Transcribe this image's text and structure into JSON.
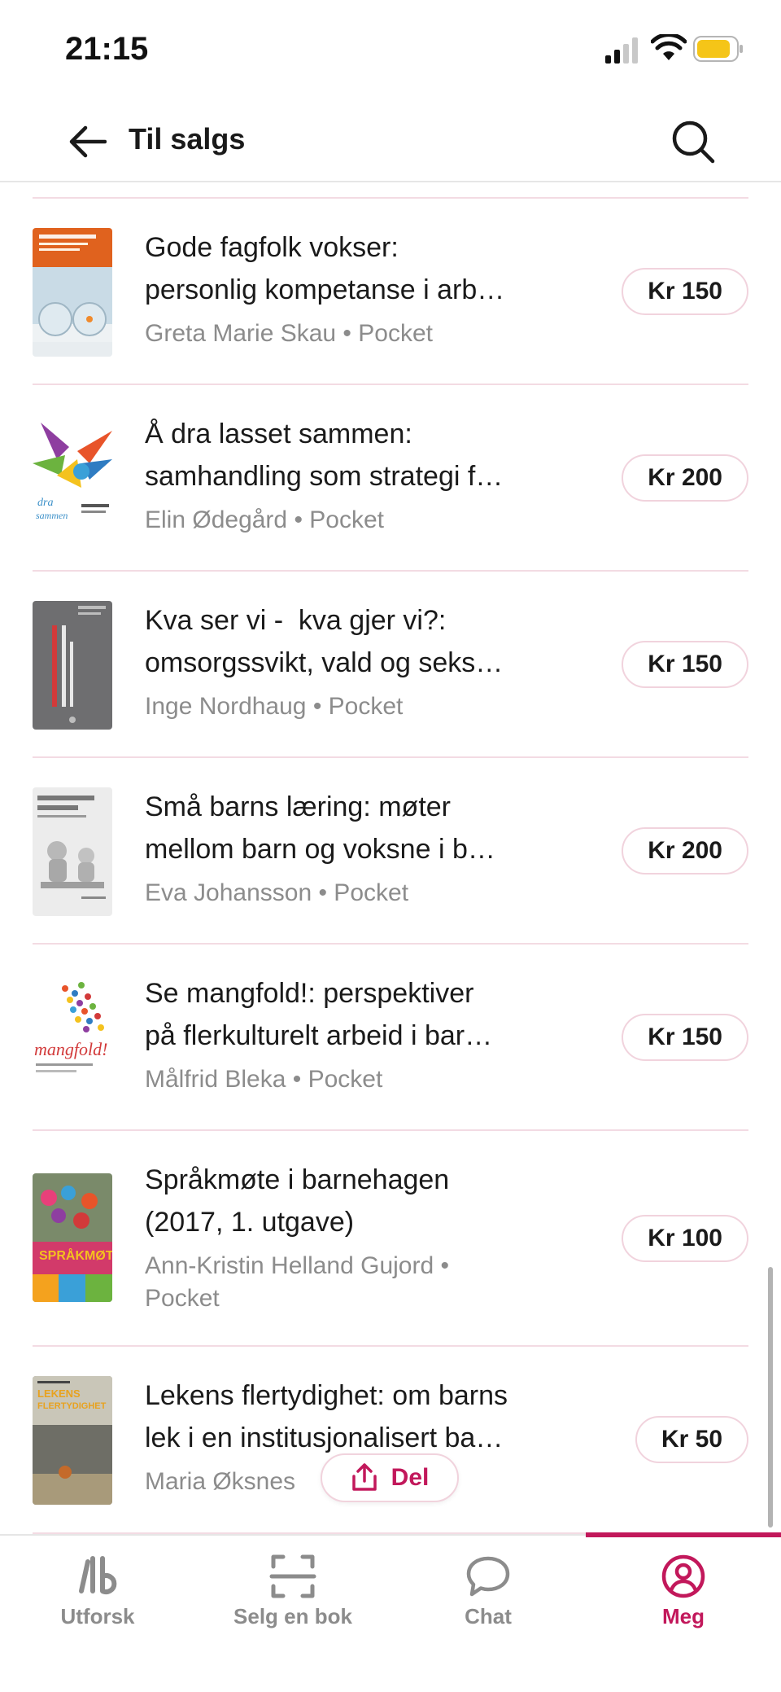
{
  "status_bar": {
    "time": "21:15"
  },
  "header": {
    "title": "Til salgs"
  },
  "books": [
    {
      "title_line1": "Gode fagfolk vokser:",
      "title_line2": "personlig kompetanse i arb…",
      "meta": "Greta Marie Skau • Pocket",
      "price": "Kr 150"
    },
    {
      "title_line1": "Å dra lasset sammen:",
      "title_line2": "samhandling som strategi f…",
      "meta": "Elin Ødegård • Pocket",
      "price": "Kr 200"
    },
    {
      "title_line1": "Kva ser vi -  kva gjer vi?:",
      "title_line2": "omsorgssvikt, vald og seks…",
      "meta": "Inge Nordhaug • Pocket",
      "price": "Kr 150"
    },
    {
      "title_line1": "Små barns læring: møter",
      "title_line2": "mellom barn og voksne i b…",
      "meta": "Eva Johansson • Pocket",
      "price": "Kr 200"
    },
    {
      "title_line1": "Se mangfold!: perspektiver",
      "title_line2": "på flerkulturelt arbeid i bar…",
      "meta": "Målfrid Bleka • Pocket",
      "price": "Kr 150"
    },
    {
      "title_line1": "Språkmøte i barnehagen",
      "title_line2": "(2017, 1. utgave)",
      "meta_line1": "Ann-Kristin Helland Gujord •",
      "meta_line2": "Pocket",
      "price": "Kr 100"
    },
    {
      "title_line1": "Lekens flertydighet: om barns",
      "title_line2": "lek i en institusjonalisert ba…",
      "meta": "Maria Øksnes",
      "price": "Kr 50"
    }
  ],
  "share": {
    "label": "Del"
  },
  "bottom_nav": {
    "items": [
      {
        "label": "Utforsk",
        "icon": "lb-logo-icon"
      },
      {
        "label": "Selg en bok",
        "icon": "scan-icon"
      },
      {
        "label": "Chat",
        "icon": "chat-bubble-icon"
      },
      {
        "label": "Meg",
        "icon": "user-circle-icon"
      }
    ],
    "active_index": 3
  },
  "colors": {
    "accent": "#c2185b",
    "divider": "#f3dbe3",
    "muted": "#8c8c8c",
    "battery": "#f5c518"
  }
}
